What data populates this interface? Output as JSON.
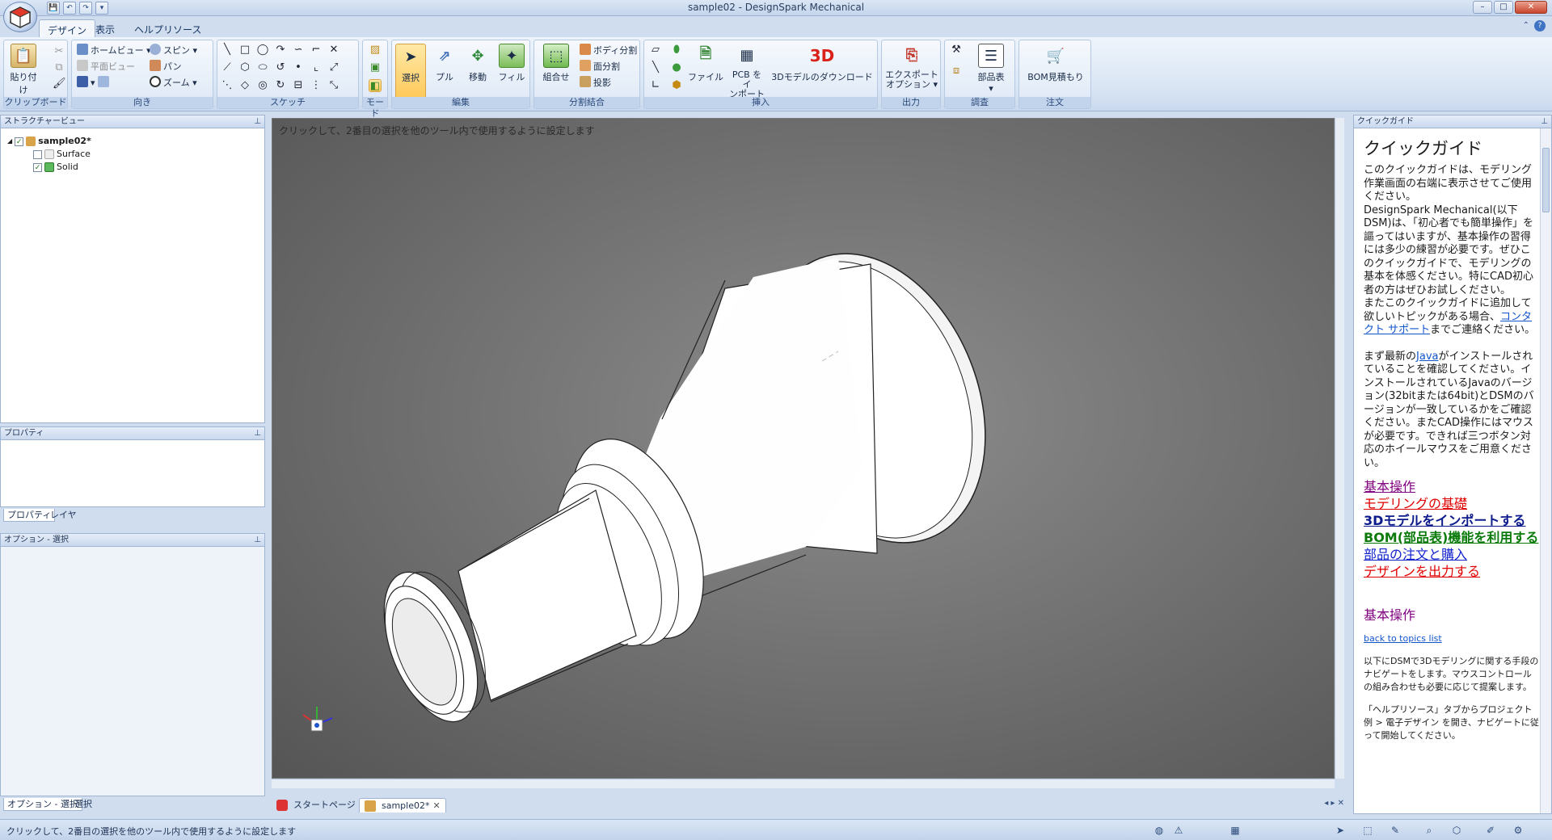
{
  "window": {
    "title": "sample02 - DesignSpark Mechanical",
    "qat": [
      "💾",
      "↶",
      "↷",
      "▾"
    ],
    "controls": [
      "–",
      "□",
      "✕"
    ]
  },
  "ribbon_tabs": [
    "デザイン",
    "表示",
    "ヘルプリソース"
  ],
  "ribbon": {
    "clipboard": {
      "label": "クリップボード",
      "paste": "貼り付け"
    },
    "orient": {
      "label": "向き",
      "home": "ホームビュー",
      "plan": "平面ビュー",
      "spin": "スピン",
      "pan": "パン",
      "zoom": "ズーム"
    },
    "sketch": {
      "label": "スケッチ"
    },
    "mode": {
      "label": "モード"
    },
    "edit": {
      "label": "編集",
      "select": "選択",
      "pull": "プル",
      "move": "移動",
      "fill": "フィル"
    },
    "intersect": {
      "label": "分割結合",
      "combine": "組合せ",
      "split_body": "ボディ分割",
      "split_face": "面分割",
      "project": "投影"
    },
    "insert": {
      "label": "挿入",
      "file": "ファイル",
      "pcb1": "PCB をイ",
      "pcb2": "ンポート",
      "download": "3Dモデルのダウンロード"
    },
    "output": {
      "label": "出力",
      "export1": "エクスポート",
      "export2": "オプション"
    },
    "inspect": {
      "label": "調査",
      "bom": "部品表"
    },
    "order": {
      "label": "注文",
      "bom_quote": "BOM見積もり"
    }
  },
  "structure_tree": {
    "title": "ストラクチャービュー",
    "root": "sample02*",
    "children": [
      "Surface",
      "Solid"
    ]
  },
  "properties": {
    "title": "プロパティ",
    "tabs": [
      "プロパティ",
      "レイヤ"
    ]
  },
  "options": {
    "title": "オプション - 選択",
    "tabs": [
      "オプション - 選択",
      "選択"
    ]
  },
  "viewport": {
    "hint": "クリックして、2番目の選択を他のツール内で使用するように設定します"
  },
  "doc_tabs": [
    "スタートページ",
    "sample02*"
  ],
  "quick_guide": {
    "header": "クイックガイド",
    "title": "クイックガイド",
    "para1": "このクイックガイドは、モデリング作業画面の右端に表示させてご使用ください。",
    "para2": "DesignSpark Mechanical(以下DSM)は、「初心者でも簡単操作」を謳ってはいますが、基本操作の習得には多少の練習が必要です。ぜひこのクイックガイドで、モデリングの基本を体感ください。特にCAD初心者の方はぜひお試しください。",
    "para3a": "またこのクイックガイドに追加して欲しいトピックがある場合、",
    "para3link": "コンタクト サポート",
    "para3b": "までご連絡ください。",
    "para4a": "まず最新の",
    "para4link": "Java",
    "para4b": "がインストールされていることを確認してください。インストールされているJavaのバージョン(32bitまたは64bit)とDSMのバージョンが一致しているかをご確認ください。またCAD操作にはマウスが必要です。できれば三つボタン対応のホイールマウスをご用意ください。",
    "topics": [
      {
        "label": "基本操作",
        "color": "#800080"
      },
      {
        "label": "モデリングの基礎",
        "color": "#e00000"
      },
      {
        "label": "3Dモデルをインポートする",
        "color": "#0b1a8c"
      },
      {
        "label": "BOM(部品表)機能を利用する",
        "color": "#0a7a0a"
      },
      {
        "label": "部品の注文と購入",
        "color": "#1122cc"
      },
      {
        "label": "デザインを出力する",
        "color": "#e00000"
      }
    ],
    "section_title": "基本操作",
    "back_link": "back to topics list",
    "para5": "以下にDSMで3Dモデリングに関する手段のナビゲートをします。マウスコントロールの組み合わせも必要に応じて提案します。",
    "para6": "「ヘルプリソース」タブからプロジェクト例 > 電子デザイン を開き、ナビゲートに従って開始してください。"
  },
  "status": {
    "text": "クリックして、2番目の選択を他のツール内で使用するように設定します"
  }
}
